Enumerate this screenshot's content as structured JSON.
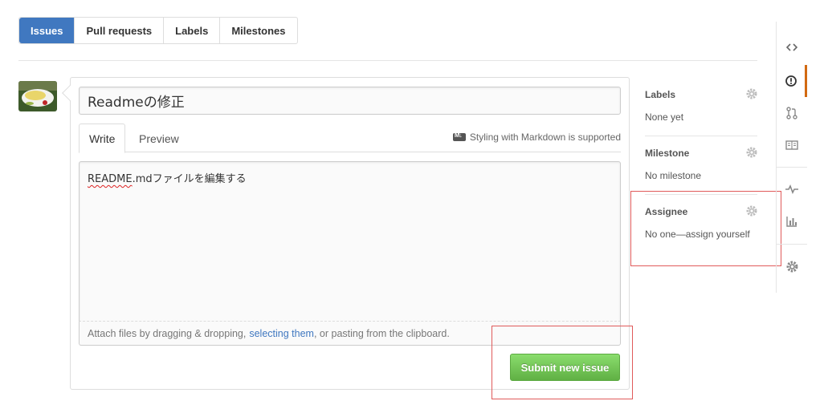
{
  "tabs": [
    {
      "label": "Issues",
      "selected": true
    },
    {
      "label": "Pull requests",
      "selected": false
    },
    {
      "label": "Labels",
      "selected": false
    },
    {
      "label": "Milestones",
      "selected": false
    }
  ],
  "form": {
    "title_value": "Readmeの修正",
    "write_tab": "Write",
    "preview_tab": "Preview",
    "markdown_hint": "Styling with Markdown is supported",
    "body_spell": "README",
    "body_rest": ".mdファイルを編集する",
    "attach_prefix": "Attach files by dragging & dropping,",
    "attach_link": "selecting them",
    "attach_suffix": ", or pasting from the clipboard.",
    "submit_label": "Submit new issue"
  },
  "sidebar": {
    "labels": {
      "heading": "Labels",
      "value": "None yet"
    },
    "milestone": {
      "heading": "Milestone",
      "value": "No milestone"
    },
    "assignee": {
      "heading": "Assignee",
      "value": "No one—assign yourself"
    }
  },
  "colors": {
    "accent": "#4078c0",
    "submit_green": "#60b044",
    "active_nav": "#d26911",
    "highlight_red": "#e05a5a"
  },
  "icons": [
    "code-icon",
    "issue-opened-icon",
    "pull-request-icon",
    "wiki-book-icon",
    "pulse-icon",
    "graph-icon",
    "gear-icon",
    "markdown-icon"
  ]
}
